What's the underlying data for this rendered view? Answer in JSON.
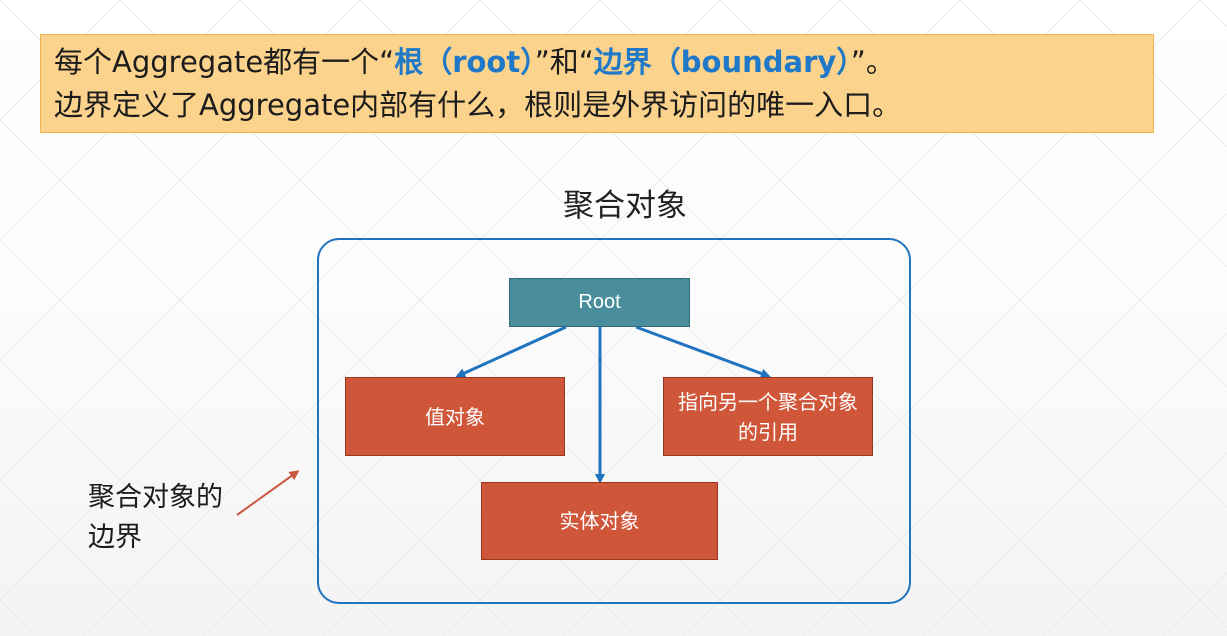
{
  "callout": {
    "line1_a": "每个Aggregate都有一个“",
    "line1_root": "根（root）",
    "line1_b": "”和“",
    "line1_boundary": "边界（boundary）",
    "line1_c": "”。",
    "line2": "边界定义了Aggregate内部有什么，根则是外界访问的唯一入口。"
  },
  "diagram": {
    "title": "聚合对象",
    "root_label": "Root",
    "value_object_label": "值对象",
    "reference_label": "指向另一个聚合对象的引用",
    "entity_label": "实体对象",
    "boundary_label": "聚合对象的边界"
  },
  "colors": {
    "callout_bg": "#fbd38d",
    "highlight": "#1f78c8",
    "boundary": "#1f73bf",
    "root_fill": "#4a8e9e",
    "node_fill": "#d0563a",
    "pointer": "#c9553d"
  }
}
